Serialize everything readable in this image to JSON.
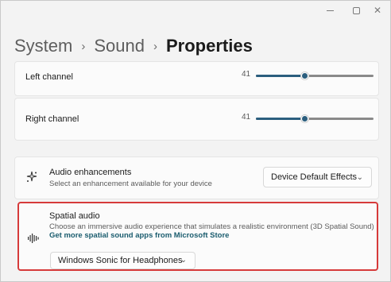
{
  "breadcrumb": {
    "items": [
      "System",
      "Sound"
    ],
    "separator": "›",
    "current": "Properties"
  },
  "left_channel": {
    "label": "Left channel",
    "value": "41",
    "level": 0.41
  },
  "right_channel": {
    "label": "Right channel",
    "value": "41",
    "level": 0.41
  },
  "audio_enhancements": {
    "icon": "sparkle-icon",
    "title": "Audio enhancements",
    "subtitle": "Select an enhancement available for your device",
    "selected": "Device Default Effects"
  },
  "spatial_audio": {
    "icon": "sound-waves-icon",
    "title": "Spatial audio",
    "subtitle": "Choose an immersive audio experience that simulates a realistic environment (3D Spatial Sound)",
    "link": "Get more spatial sound apps from Microsoft Store",
    "selected": "Windows Sonic for Headphones"
  },
  "colors": {
    "accent": "#2b5e7e",
    "highlight_border": "#d63a3a"
  }
}
